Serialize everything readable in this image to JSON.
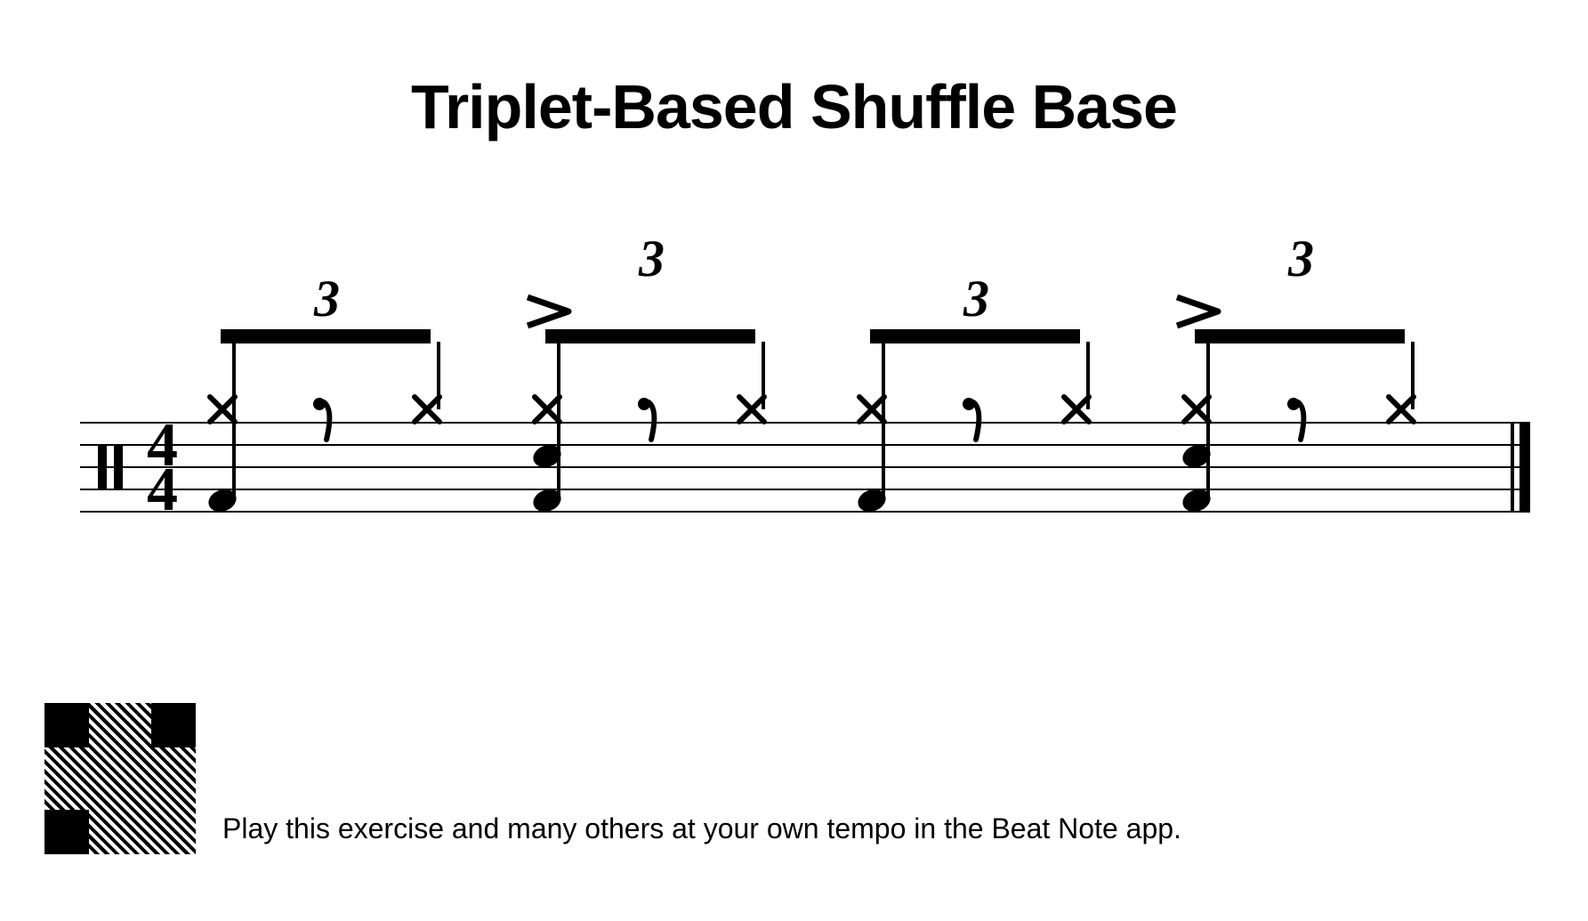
{
  "title": "Triplet-Based Shuffle Base",
  "footer_text": "Play this exercise and many others at your own tempo in the Beat Note app.",
  "time_signature": {
    "top": "4",
    "bottom": "4"
  },
  "tuplet_label": "3",
  "beats": [
    {
      "tuplet": "3",
      "accent": false,
      "notes": [
        {
          "pos": 1,
          "hihat": true,
          "rest": false,
          "snare": false,
          "bass": true
        },
        {
          "pos": 2,
          "hihat": false,
          "rest": true,
          "snare": false,
          "bass": false
        },
        {
          "pos": 3,
          "hihat": true,
          "rest": false,
          "snare": false,
          "bass": false
        }
      ]
    },
    {
      "tuplet": "3",
      "accent": true,
      "notes": [
        {
          "pos": 1,
          "hihat": true,
          "rest": false,
          "snare": true,
          "bass": true
        },
        {
          "pos": 2,
          "hihat": false,
          "rest": true,
          "snare": false,
          "bass": false
        },
        {
          "pos": 3,
          "hihat": true,
          "rest": false,
          "snare": false,
          "bass": false
        }
      ]
    },
    {
      "tuplet": "3",
      "accent": false,
      "notes": [
        {
          "pos": 1,
          "hihat": true,
          "rest": false,
          "snare": false,
          "bass": true
        },
        {
          "pos": 2,
          "hihat": false,
          "rest": true,
          "snare": false,
          "bass": false
        },
        {
          "pos": 3,
          "hihat": true,
          "rest": false,
          "snare": false,
          "bass": false
        }
      ]
    },
    {
      "tuplet": "3",
      "accent": true,
      "notes": [
        {
          "pos": 1,
          "hihat": true,
          "rest": false,
          "snare": true,
          "bass": true
        },
        {
          "pos": 2,
          "hihat": false,
          "rest": true,
          "snare": false,
          "bass": false
        },
        {
          "pos": 3,
          "hihat": true,
          "rest": false,
          "snare": false,
          "bass": false
        }
      ]
    }
  ]
}
